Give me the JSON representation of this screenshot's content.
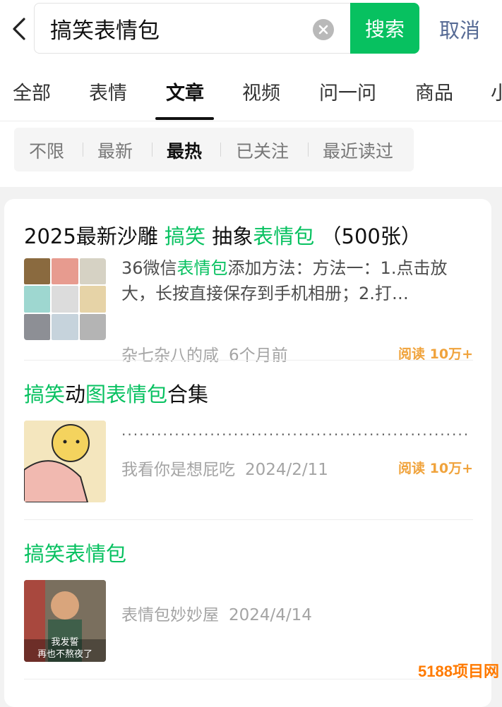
{
  "search": {
    "query": "搞笑表情包",
    "button_label": "搜索",
    "cancel_label": "取消"
  },
  "tabs": [
    {
      "label": "全部"
    },
    {
      "label": "表情"
    },
    {
      "label": "文章"
    },
    {
      "label": "视频"
    },
    {
      "label": "问一问"
    },
    {
      "label": "商品"
    },
    {
      "label": "小"
    }
  ],
  "active_tab": "文章",
  "filters": [
    {
      "label": "不限"
    },
    {
      "label": "最新"
    },
    {
      "label": "最热"
    },
    {
      "label": "已关注"
    },
    {
      "label": "最近读过"
    }
  ],
  "active_filter": "最热",
  "results": [
    {
      "title_parts": [
        {
          "text": "2025最新沙雕 ",
          "hl": false
        },
        {
          "text": "搞笑",
          "hl": true
        },
        {
          "text": " 抽象",
          "hl": false
        },
        {
          "text": "表情包",
          "hl": true
        },
        {
          "text": " （500张）",
          "hl": false
        }
      ],
      "snippet_parts": [
        {
          "text": "36微信",
          "hl": false
        },
        {
          "text": "表情包",
          "hl": true
        },
        {
          "text": "添加方法：方法一：1.点击放大，长按直接保存到手机相册；2.打…",
          "hl": false
        }
      ],
      "author": "杂七杂八的咸",
      "time": "6个月前",
      "reads": "阅读 10万+"
    },
    {
      "title_parts": [
        {
          "text": "搞笑",
          "hl": true
        },
        {
          "text": "动",
          "hl": false
        },
        {
          "text": "图表情包",
          "hl": true
        },
        {
          "text": "合集",
          "hl": false
        }
      ],
      "snippet": "...........................................................…",
      "author": "我看你是想屁吃",
      "time": "2024/2/11",
      "reads": "阅读 10万+"
    },
    {
      "title_parts": [
        {
          "text": "搞笑表情包",
          "hl": true
        }
      ],
      "author": "表情包妙妙屋",
      "time": "2024/4/14",
      "thumb_caption_1": "我发誓",
      "thumb_caption_2": "再也不熬夜了"
    }
  ],
  "watermark": "5188项目网",
  "colors": {
    "accent_green": "#07c160",
    "link_blue": "#576b95",
    "reads_orange": "#f0a33c"
  }
}
